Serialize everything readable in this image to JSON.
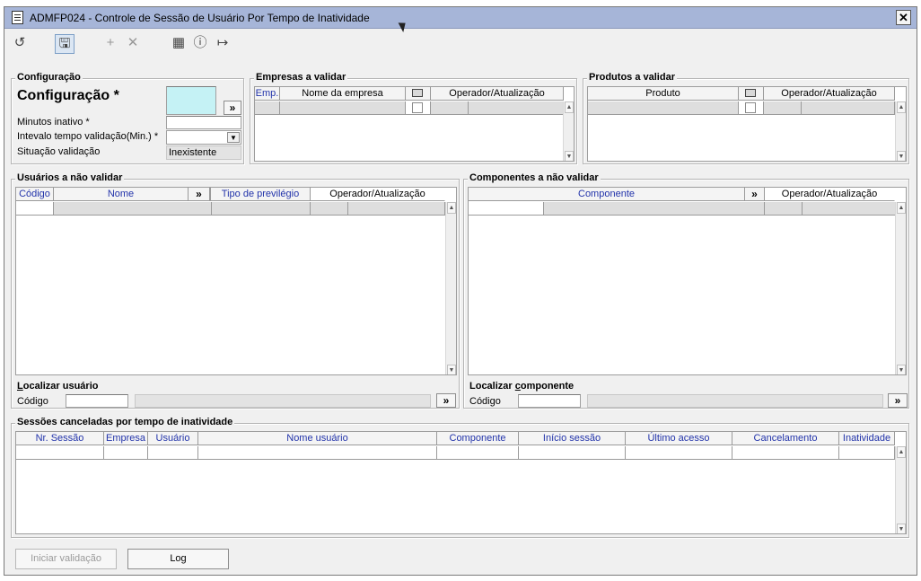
{
  "window": {
    "title": "ADMFP024 - Controle de Sessão de Usuário Por Tempo de Inatividade",
    "close_label": "✕"
  },
  "toolbar": {
    "undo_icon": "undo-icon",
    "save_icon": "save-icon",
    "add_icon": "plus-icon",
    "delete_icon": "x-icon",
    "calendar_icon": "calendar-icon",
    "help_icon": "help-icon",
    "exit_icon": "exit-icon"
  },
  "config": {
    "group_title": "Configuração",
    "big_label": "Configuração *",
    "minutos_label": "Minutos inativo *",
    "intervalo_label": "Intevalo tempo validação(Min.) *",
    "situacao_label": "Situação validação",
    "situacao_value": "Inexistente",
    "lookup_label": "»"
  },
  "empresas": {
    "title": "Empresas a validar",
    "columns": [
      "Emp.",
      "Nome da empresa",
      "",
      "Operador/Atualização"
    ]
  },
  "produtos": {
    "title": "Produtos a validar",
    "columns": [
      "Produto",
      "",
      "Operador/Atualização"
    ]
  },
  "usuarios": {
    "title": "Usuários a não validar",
    "columns": [
      "Código",
      "Nome",
      "»",
      "Tipo de previlégio",
      "Operador/Atualização"
    ],
    "search_title_pre": "L",
    "search_title_rest": "ocalizar usuário",
    "search_label": "Código",
    "search_btn": "»"
  },
  "componentes": {
    "title": "Componentes a não validar",
    "columns": [
      "Componente",
      "»",
      "Operador/Atualização"
    ],
    "search_title_pre": "Localizar ",
    "search_title_u": "c",
    "search_title_rest": "omponente",
    "search_label": "Código",
    "search_btn": "»"
  },
  "sessoes": {
    "title": "Sessões canceladas por tempo de inatividade",
    "columns": [
      "Nr. Sessão",
      "Empresa",
      "Usuário",
      "Nome usuário",
      "Componente",
      "Início sessão",
      "Último acesso",
      "Cancelamento",
      "Inatividade"
    ]
  },
  "buttons": {
    "iniciar": "Iniciar validação",
    "log": "Log"
  }
}
